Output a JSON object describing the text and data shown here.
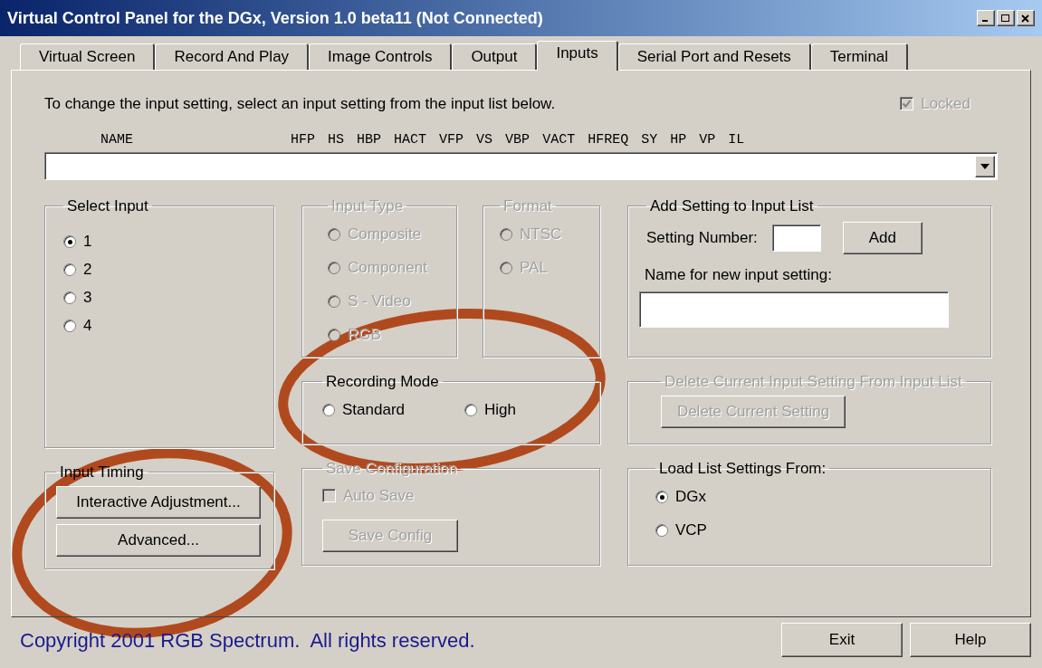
{
  "window": {
    "title": "Virtual Control Panel for the DGx, Version 1.0 beta11 (Not Connected)"
  },
  "tabs": [
    {
      "label": "Virtual Screen",
      "selected": false
    },
    {
      "label": "Record And Play",
      "selected": false
    },
    {
      "label": "Image Controls",
      "selected": false
    },
    {
      "label": "Output",
      "selected": false
    },
    {
      "label": "Inputs",
      "selected": true
    },
    {
      "label": "Serial Port and Resets",
      "selected": false
    },
    {
      "label": "Terminal",
      "selected": false
    }
  ],
  "instruction": "To change the input setting, select an input setting from the input list below.",
  "locked": {
    "label": "Locked",
    "checked": true,
    "disabled": true
  },
  "input_list": {
    "columns": [
      "NAME",
      "HFP",
      "HS",
      "HBP",
      "HACT",
      "VFP",
      "VS",
      "VBP",
      "VACT",
      "HFREQ",
      "SY",
      "HP",
      "VP",
      "IL"
    ]
  },
  "select_input": {
    "title": "Select Input",
    "disabled": false,
    "options": [
      {
        "label": "1",
        "selected": true
      },
      {
        "label": "2",
        "selected": false
      },
      {
        "label": "3",
        "selected": false
      },
      {
        "label": "4",
        "selected": false
      }
    ]
  },
  "input_type": {
    "title": "Input Type",
    "disabled": true,
    "options": [
      {
        "label": "Composite",
        "selected": false
      },
      {
        "label": "Component",
        "selected": false
      },
      {
        "label": "S - Video",
        "selected": false
      },
      {
        "label": "RGB",
        "selected": false
      }
    ]
  },
  "format": {
    "title": "Format",
    "disabled": true,
    "options": [
      {
        "label": "NTSC",
        "selected": false
      },
      {
        "label": "PAL",
        "selected": false
      }
    ]
  },
  "recording_mode": {
    "title": "Recording Mode",
    "disabled": false,
    "options": [
      {
        "label": "Standard",
        "selected": false
      },
      {
        "label": "High",
        "selected": false
      }
    ]
  },
  "add_setting": {
    "title": "Add Setting to Input List",
    "number_label": "Setting Number:",
    "add_button": "Add",
    "name_label": "Name for new input setting:"
  },
  "delete_setting": {
    "title": "Delete Current Input Setting From Input List",
    "disabled": true,
    "button": "Delete Current Setting"
  },
  "input_timing": {
    "title": "Input Timing",
    "buttons": [
      "Interactive Adjustment...",
      "Advanced..."
    ]
  },
  "save_configuration": {
    "title": "Save Configuration",
    "disabled": true,
    "auto_save": {
      "label": "Auto Save",
      "checked": false
    },
    "button": "Save Config"
  },
  "load_list": {
    "title": "Load List Settings From:",
    "disabled": false,
    "options": [
      {
        "label": "DGx",
        "selected": true
      },
      {
        "label": "VCP",
        "selected": false
      }
    ]
  },
  "footer": {
    "copyright": "Copyright 2001 RGB Spectrum.  All rights reserved.",
    "buttons": [
      "Exit",
      "Help"
    ]
  }
}
